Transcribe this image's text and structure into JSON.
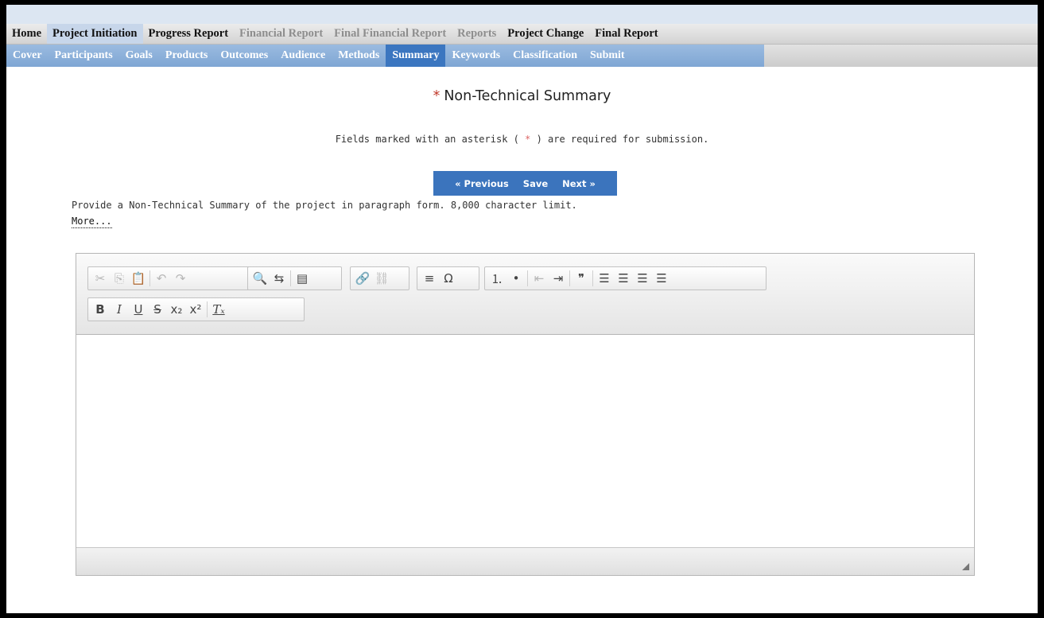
{
  "menu_primary": [
    {
      "label": "Home",
      "state": "normal"
    },
    {
      "label": "Project Initiation",
      "state": "active"
    },
    {
      "label": "Progress Report",
      "state": "normal"
    },
    {
      "label": "Financial Report",
      "state": "disabled"
    },
    {
      "label": "Final Financial Report",
      "state": "disabled"
    },
    {
      "label": "Reports",
      "state": "disabled"
    },
    {
      "label": "Project Change",
      "state": "normal"
    },
    {
      "label": "Final Report",
      "state": "normal"
    }
  ],
  "menu_secondary": [
    {
      "label": "Cover",
      "state": "normal"
    },
    {
      "label": "Participants",
      "state": "normal"
    },
    {
      "label": "Goals",
      "state": "normal"
    },
    {
      "label": "Products",
      "state": "normal"
    },
    {
      "label": "Outcomes",
      "state": "normal"
    },
    {
      "label": "Audience",
      "state": "normal"
    },
    {
      "label": "Methods",
      "state": "normal"
    },
    {
      "label": "Summary",
      "state": "active"
    },
    {
      "label": "Keywords",
      "state": "normal"
    },
    {
      "label": "Classification",
      "state": "normal"
    },
    {
      "label": "Submit",
      "state": "normal"
    }
  ],
  "page": {
    "required_marker": "*",
    "title": "Non-Technical Summary",
    "note_before": "Fields marked with an asterisk (",
    "note_marker": " * ",
    "note_after": ") are required for submission.",
    "description": "Provide a Non-Technical Summary of the project in paragraph form.  8,000 character limit.",
    "more_link": "More..."
  },
  "nav_buttons": {
    "previous": "« Previous",
    "save": "Save",
    "next": "Next »"
  },
  "colors": {
    "menu_secondary_bg": "#8fb1dc",
    "active_tab": "#3b76c0",
    "nav_bar": "#3b74bd",
    "required_marker": "#c0392b"
  },
  "editor": {
    "content": "",
    "toolbar_row1": [
      [
        {
          "icon": "cut-icon",
          "glyph": "✂",
          "disabled": true
        },
        {
          "icon": "copy-icon",
          "glyph": "⎘",
          "disabled": true
        },
        {
          "icon": "paste-icon",
          "glyph": "📋",
          "disabled": false
        },
        {
          "sep": true
        },
        {
          "icon": "undo-icon",
          "glyph": "↶",
          "disabled": true
        },
        {
          "icon": "redo-icon",
          "glyph": "↷",
          "disabled": true
        }
      ],
      [
        {
          "icon": "find-icon",
          "glyph": "🔍",
          "disabled": false
        },
        {
          "icon": "replace-icon",
          "glyph": "⇆",
          "disabled": false
        },
        {
          "sep": true
        },
        {
          "icon": "spellcheck-icon",
          "glyph": "▤",
          "disabled": false
        }
      ],
      [
        {
          "icon": "link-icon",
          "glyph": "🔗",
          "disabled": false
        },
        {
          "icon": "unlink-icon",
          "glyph": "⛓",
          "disabled": true
        }
      ],
      [
        {
          "icon": "horizontal-rule-icon",
          "glyph": "≡",
          "disabled": false
        },
        {
          "icon": "special-char-icon",
          "glyph": "Ω",
          "disabled": false
        }
      ],
      [
        {
          "icon": "numbered-list-icon",
          "glyph": "⒈",
          "disabled": false
        },
        {
          "icon": "bulleted-list-icon",
          "glyph": "•",
          "disabled": false
        },
        {
          "sep": true
        },
        {
          "icon": "outdent-icon",
          "glyph": "⇤",
          "disabled": true
        },
        {
          "icon": "indent-icon",
          "glyph": "⇥",
          "disabled": false
        },
        {
          "sep": true
        },
        {
          "icon": "blockquote-icon",
          "glyph": "❞",
          "disabled": false
        },
        {
          "sep": true
        },
        {
          "icon": "align-left-icon",
          "glyph": "☰",
          "disabled": false
        },
        {
          "icon": "align-center-icon",
          "glyph": "☰",
          "disabled": false
        },
        {
          "icon": "align-right-icon",
          "glyph": "☰",
          "disabled": false
        },
        {
          "icon": "justify-icon",
          "glyph": "☰",
          "disabled": false
        }
      ]
    ],
    "toolbar_row2": [
      [
        {
          "icon": "bold-icon",
          "glyph": "B",
          "disabled": false
        },
        {
          "icon": "italic-icon",
          "glyph": "I",
          "disabled": false
        },
        {
          "icon": "underline-icon",
          "glyph": "U",
          "disabled": false
        },
        {
          "icon": "strikethrough-icon",
          "glyph": "S",
          "disabled": false
        },
        {
          "icon": "subscript-icon",
          "glyph": "x₂",
          "disabled": false
        },
        {
          "icon": "superscript-icon",
          "glyph": "x²",
          "disabled": false
        },
        {
          "sep": true
        },
        {
          "icon": "remove-format-icon",
          "glyph": "Tₓ",
          "disabled": false
        }
      ]
    ]
  }
}
